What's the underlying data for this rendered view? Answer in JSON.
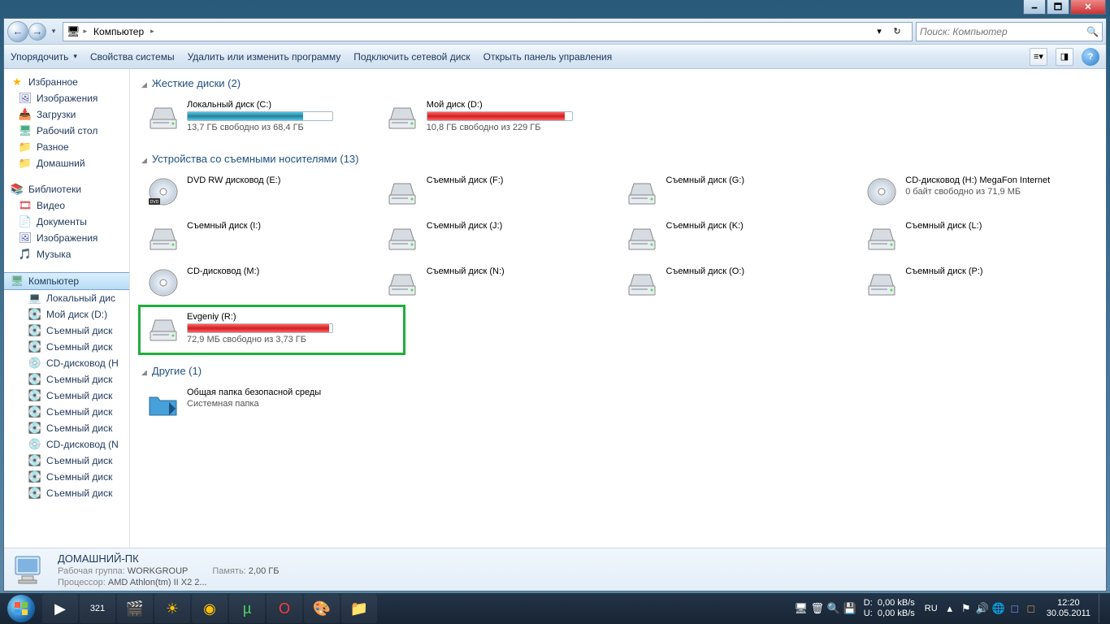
{
  "winctl": {
    "min": "🗕",
    "max": "🗖",
    "close": "✕"
  },
  "navbar": {
    "back": "←",
    "computer_icon": "🖥",
    "crumb": "Компьютер",
    "refresh": "↻",
    "dropdown": "▾",
    "search_placeholder": "Поиск: Компьютер",
    "search_icon": "🔍"
  },
  "toolbar": {
    "organize": "Упорядочить",
    "props": "Свойства системы",
    "uninstall": "Удалить или изменить программу",
    "mapnet": "Подключить сетевой диск",
    "ctrlpanel": "Открыть панель управления",
    "help": "?"
  },
  "tree": {
    "favorites": {
      "label": "Избранное",
      "items": [
        "Изображения",
        "Загрузки",
        "Рабочий стол",
        "Разное",
        "Домашний"
      ]
    },
    "libraries": {
      "label": "Библиотеки",
      "items": [
        "Видео",
        "Документы",
        "Изображения",
        "Музыка"
      ]
    },
    "computer": {
      "label": "Компьютер",
      "items": [
        "Локальный дис",
        "Мой диск (D:)",
        "Съемный диск",
        "Съемный диск",
        "CD-дисковод (H",
        "Съемный диск",
        "Съемный диск",
        "Съемный диск",
        "Съемный диск",
        "CD-дисковод (N",
        "Съемный диск",
        "Съемный диск",
        "Съемный диск"
      ]
    }
  },
  "sections": {
    "hdd": "Жесткие диски (2)",
    "removable": "Устройства со съемными носителями (13)",
    "other": "Другие (1)"
  },
  "drives": {
    "hdd": [
      {
        "label": "Локальный диск (C:)",
        "sub": "13,7 ГБ свободно из 68,4 ГБ",
        "fill": 80,
        "color": "teal"
      },
      {
        "label": "Мой диск (D:)",
        "sub": "10,8 ГБ свободно из 229 ГБ",
        "fill": 95,
        "color": "red"
      }
    ],
    "removable": [
      {
        "label": "DVD RW дисковод (E:)",
        "type": "dvd"
      },
      {
        "label": "Съемный диск (F:)",
        "type": "rem"
      },
      {
        "label": "Съемный диск (G:)",
        "type": "rem"
      },
      {
        "label": "CD-дисковод (H:) MegaFon Internet",
        "sub": "0 байт свободно из 71,9 МБ",
        "type": "cd"
      },
      {
        "label": "Съемный диск (I:)",
        "type": "rem"
      },
      {
        "label": "Съемный диск (J:)",
        "type": "rem"
      },
      {
        "label": "Съемный диск (K:)",
        "type": "rem"
      },
      {
        "label": "Съемный диск (L:)",
        "type": "rem"
      },
      {
        "label": "CD-дисковод (M:)",
        "type": "cd"
      },
      {
        "label": "Съемный диск (N:)",
        "type": "rem"
      },
      {
        "label": "Съемный диск (O:)",
        "type": "rem"
      },
      {
        "label": "Съемный диск (P:)",
        "type": "rem"
      },
      {
        "label": "Evgeniy (R:)",
        "sub": "72,9 МБ свободно из 3,73 ГБ",
        "fill": 98,
        "color": "red",
        "type": "rem",
        "highlighted": true
      }
    ],
    "other": [
      {
        "label": "Общая папка безопасной среды",
        "sub": "Системная папка",
        "type": "folder"
      }
    ]
  },
  "details": {
    "title": "ДОМАШНИЙ-ПК",
    "workgroup_k": "Рабочая группа:",
    "workgroup_v": "WORKGROUP",
    "memory_k": "Память:",
    "memory_v": "2,00 ГБ",
    "cpu_k": "Процессор:",
    "cpu_v": "AMD Athlon(tm) II X2 2..."
  },
  "taskbar": {
    "net": {
      "d_label": "D:",
      "u_label": "U:",
      "d_val": "0,00 kB/s",
      "u_val": "0,00 kB/s"
    },
    "lang": "RU",
    "time": "12:20",
    "date": "30.05.2011"
  }
}
